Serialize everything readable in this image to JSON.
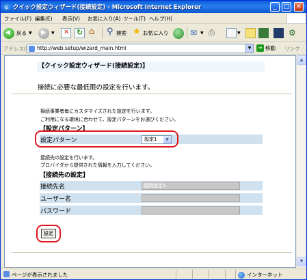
{
  "window": {
    "title": "クイック設定ウィザード(接続設定) - Microsoft Internet Explorer",
    "minimize": "_",
    "maximize": "□",
    "close": "✕"
  },
  "menu": [
    "ファイル(F)",
    "編集(E)",
    "表示(V)",
    "お気に入り(A)",
    "ツール(T)",
    "ヘルプ(H)"
  ],
  "toolbar": {
    "back_label": "戻る",
    "search_label": "検索",
    "favorites_label": "お気に入り"
  },
  "address": {
    "label": "アドレス(D)",
    "url": "http://web.setup/wizard_main.html",
    "go_label": "移動",
    "links_label": "リンク"
  },
  "page": {
    "title": "【クイック設定ウィザード(接続設定)】",
    "intro": "接続に必要な最低限の設定を行います。",
    "pattern_desc_1": "接続事業者毎にカスタマイズされた設定を行います。",
    "pattern_desc_2": "ご利用になる環境に合わせて、設定パターンをお選びください。",
    "pattern_section": "【設定パターン】",
    "pattern_label": "設定パターン",
    "pattern_value": "設定1",
    "conn_desc_1": "接続先の設定を行います。",
    "conn_desc_2": "プロバイダから提供された情報を入力してください。",
    "conn_section": "【接続先の設定】",
    "conn_name_label": "接続先名",
    "conn_name_value": "接続設定1",
    "user_label": "ユーザー名",
    "user_value": "",
    "password_label": "パスワード",
    "password_value": "",
    "set_button": "設定"
  },
  "status": {
    "text": "ページが表示されました",
    "zone": "インターネット"
  },
  "colors": {
    "title_bar": "#0a5fd8",
    "row_bg": "#cfe0ef",
    "highlight_ring": "#e0161e"
  }
}
